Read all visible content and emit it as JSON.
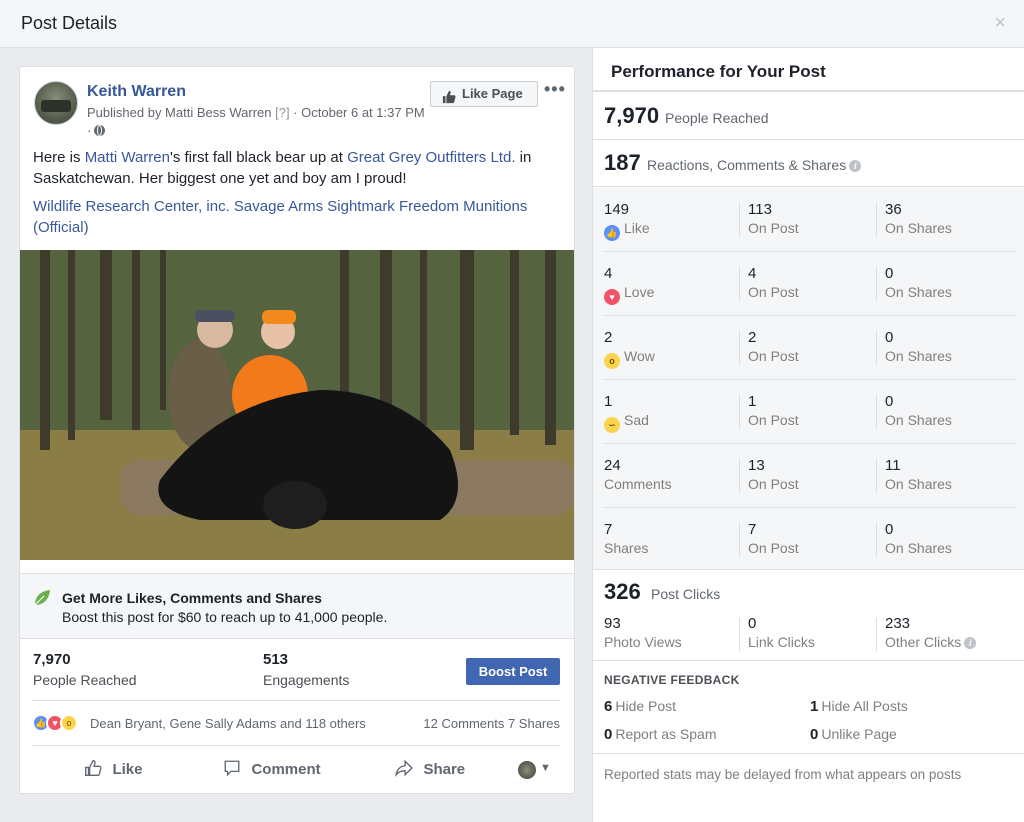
{
  "dialog": {
    "title": "Post Details",
    "close_glyph": "×"
  },
  "post": {
    "author": "Keith Warren",
    "published_prefix": "Published by Matti Bess Warren",
    "help_marker": "[?]",
    "date": " · October 6 at 1:37 PM ·",
    "like_page_label": "Like Page",
    "more_glyph": "•••",
    "text_part1": "Here is ",
    "mention1": "Matti Warren",
    "text_part2": "'s first fall black bear up at ",
    "mention2": "Great Grey Outfitters Ltd.",
    "text_part3": " in Saskatchewan. Her biggest one yet and boy am I proud!",
    "tags": "Wildlife Research Center, inc. Savage Arms Sightmark Freedom Munitions (Official)"
  },
  "boost": {
    "title": "Get More Likes, Comments and Shares",
    "desc": "Boost this post for $60 to reach up to 41,000 people.",
    "button": "Boost Post"
  },
  "summary": {
    "reached_num": "7,970",
    "reached_label": "People Reached",
    "engage_num": "513",
    "engage_label": "Engagements"
  },
  "social": {
    "names": "Dean Bryant, Gene Sally Adams and 118 others",
    "counts": "12 Comments  7 Shares"
  },
  "actions": {
    "like": "Like",
    "comment": "Comment",
    "share": "Share"
  },
  "performance": {
    "title": "Performance for Your Post",
    "reached_num": "7,970",
    "reached_label": "People Reached",
    "rcs_num": "187",
    "rcs_label": "Reactions, Comments & Shares",
    "rows": [
      {
        "a_num": "149",
        "a_label": "Like",
        "icon": "like",
        "b_num": "113",
        "b_label": "On Post",
        "c_num": "36",
        "c_label": "On Shares"
      },
      {
        "a_num": "4",
        "a_label": "Love",
        "icon": "love",
        "b_num": "4",
        "b_label": "On Post",
        "c_num": "0",
        "c_label": "On Shares"
      },
      {
        "a_num": "2",
        "a_label": "Wow",
        "icon": "wow",
        "b_num": "2",
        "b_label": "On Post",
        "c_num": "0",
        "c_label": "On Shares"
      },
      {
        "a_num": "1",
        "a_label": "Sad",
        "icon": "sad",
        "b_num": "1",
        "b_label": "On Post",
        "c_num": "0",
        "c_label": "On Shares"
      },
      {
        "a_num": "24",
        "a_label": "Comments",
        "icon": "",
        "b_num": "13",
        "b_label": "On Post",
        "c_num": "11",
        "c_label": "On Shares"
      },
      {
        "a_num": "7",
        "a_label": "Shares",
        "icon": "",
        "b_num": "7",
        "b_label": "On Post",
        "c_num": "0",
        "c_label": "On Shares"
      }
    ],
    "clicks_num": "326",
    "clicks_label": "Post Clicks",
    "photo_views_num": "93",
    "photo_views_label": "Photo Views",
    "link_clicks_num": "0",
    "link_clicks_label": "Link Clicks",
    "other_clicks_num": "233",
    "other_clicks_label": "Other Clicks",
    "negative_title": "NEGATIVE FEEDBACK",
    "hide_post_num": "6",
    "hide_post_label": "Hide Post",
    "hide_all_num": "1",
    "hide_all_label": "Hide All Posts",
    "spam_num": "0",
    "spam_label": "Report as Spam",
    "unlike_num": "0",
    "unlike_label": "Unlike Page",
    "footnote": "Reported stats may be delayed from what appears on posts"
  },
  "colors": {
    "link": "#385898",
    "boost": "#4267b2",
    "like": "#5890ff",
    "love": "#f25268",
    "wow": "#fcd34d"
  },
  "icons": {
    "like_page": "thumbs-up-icon",
    "globe": "globe-icon",
    "leaf": "leaf-icon",
    "info": "info-icon"
  }
}
